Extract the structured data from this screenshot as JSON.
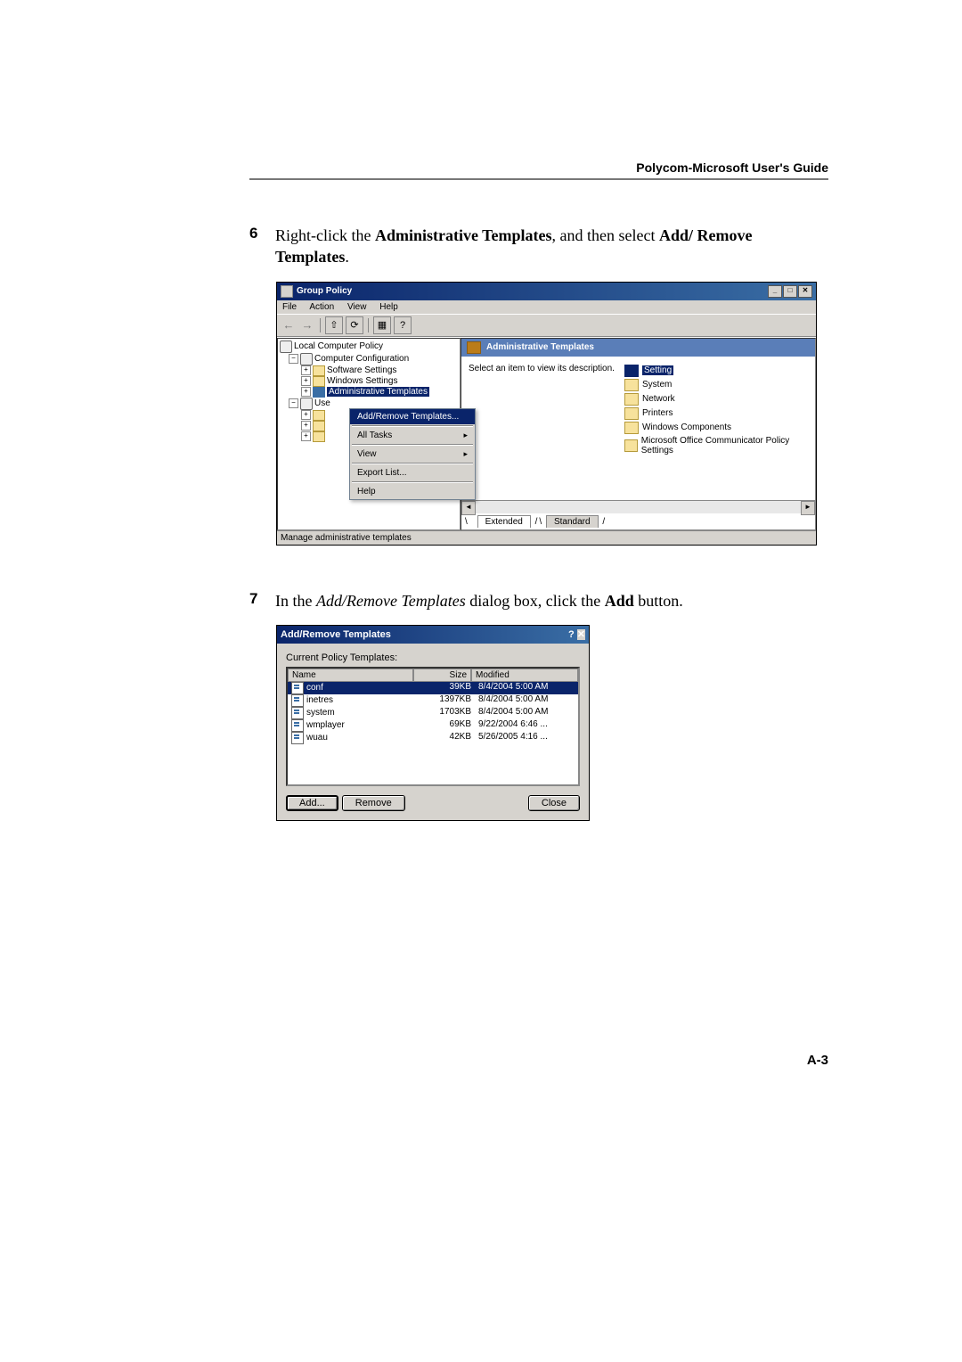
{
  "header": "Polycom-Microsoft User's Guide",
  "step6": {
    "num": "6",
    "text_pre": "Right-click the ",
    "text_bold1": "Administrative Templates",
    "text_mid": ", and then select ",
    "text_bold2": "Add/ Remove Templates",
    "text_post": "."
  },
  "gp": {
    "title": "Group Policy",
    "menu": {
      "file": "File",
      "action": "Action",
      "view": "View",
      "help": "Help"
    },
    "tree": {
      "root": "Local Computer Policy",
      "comp": "Computer Configuration",
      "soft": "Software Settings",
      "win": "Windows Settings",
      "admin": "Administrative Templates",
      "user_short": "Use"
    },
    "context": {
      "add_remove": "Add/Remove Templates...",
      "all_tasks": "All Tasks",
      "view": "View",
      "export": "Export List...",
      "help": "Help"
    },
    "panel_title": "Administrative Templates",
    "desc": "Select an item to view its description.",
    "items": {
      "setting": "Setting",
      "system": "System",
      "network": "Network",
      "printers": "Printers",
      "windows_components": "Windows Components",
      "ms_office": "Microsoft Office Communicator Policy Settings"
    },
    "tabs": {
      "extended": "Extended",
      "standard": "Standard"
    },
    "status": "Manage administrative templates"
  },
  "step7": {
    "num": "7",
    "text_pre": "In the ",
    "text_italic": "Add/Remove Templates",
    "text_mid": " dialog box, click the ",
    "text_bold": "Add",
    "text_post": " button."
  },
  "ar": {
    "title": "Add/Remove Templates",
    "label": "Current Policy Templates:",
    "cols": {
      "name": "Name",
      "size": "Size",
      "modified": "Modified"
    },
    "rows": [
      {
        "name": "conf",
        "size": "39KB",
        "mod": "8/4/2004 5:00 AM",
        "sel": true
      },
      {
        "name": "inetres",
        "size": "1397KB",
        "mod": "8/4/2004 5:00 AM"
      },
      {
        "name": "system",
        "size": "1703KB",
        "mod": "8/4/2004 5:00 AM"
      },
      {
        "name": "wmplayer",
        "size": "69KB",
        "mod": "9/22/2004 6:46 ..."
      },
      {
        "name": "wuau",
        "size": "42KB",
        "mod": "5/26/2005 4:16 ..."
      }
    ],
    "btn_add": "Add...",
    "btn_remove": "Remove",
    "btn_close": "Close"
  },
  "pagenum": "A-3"
}
